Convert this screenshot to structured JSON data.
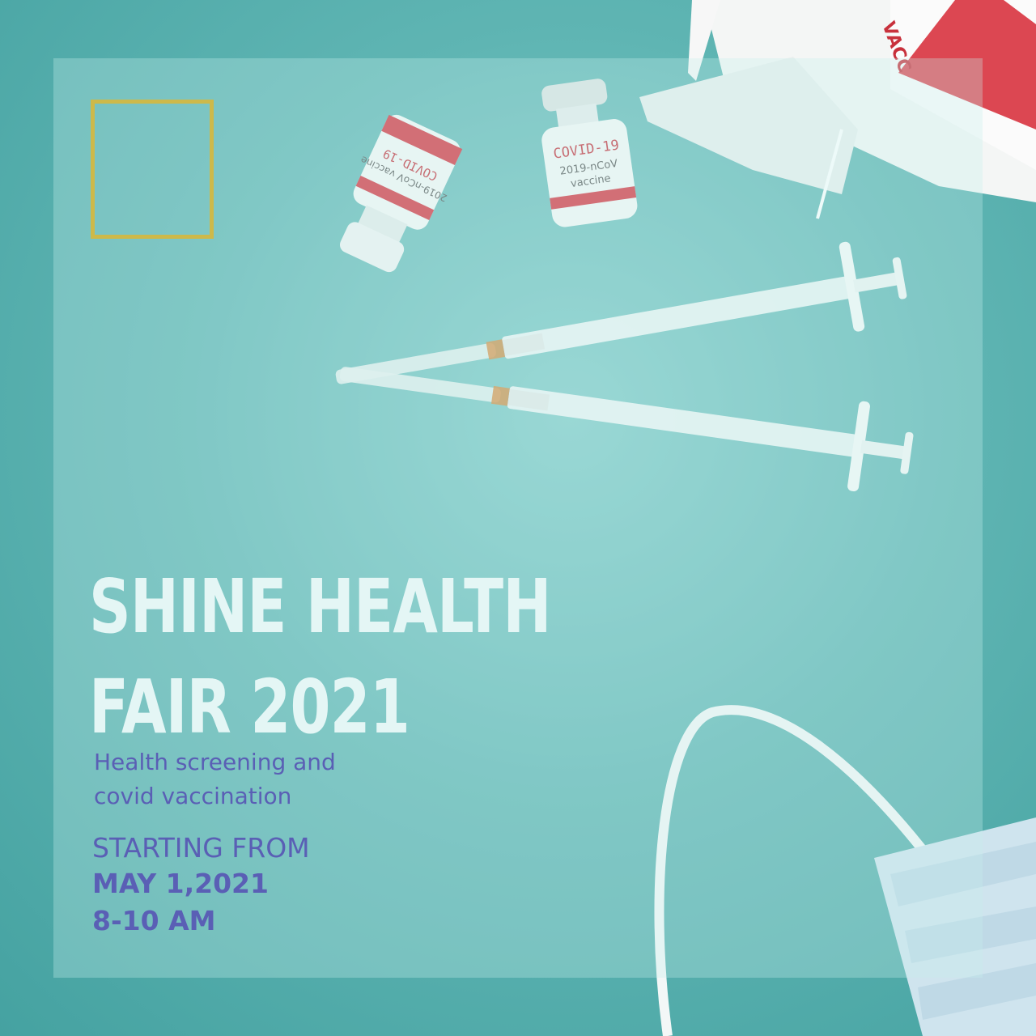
{
  "poster": {
    "headline_line1": "SHINE HEALTH",
    "headline_line2": "FAIR 2021",
    "subtitle_line1": "Health screening and",
    "subtitle_line2": "covid vaccination",
    "starting_label": "STARTING FROM",
    "date": "MAY 1,2021",
    "time": "8-10 AM"
  },
  "photo": {
    "vial_left_label": "COVID-19",
    "vial_left_sub": "2019-nCoV vaccine",
    "vial_right_label": "COVID-19",
    "vial_right_sub1": "2019-nCoV",
    "vial_right_sub2": "vaccine",
    "box_label": "VACC"
  },
  "colors": {
    "background_teal": "#5fb5b3",
    "accent_gold": "#cdb94a",
    "text_purple": "#5a5fb5",
    "headline_white": "#e4f6f5"
  },
  "icons": [
    "vaccine-vial",
    "syringe",
    "vaccine-box",
    "face-mask"
  ]
}
